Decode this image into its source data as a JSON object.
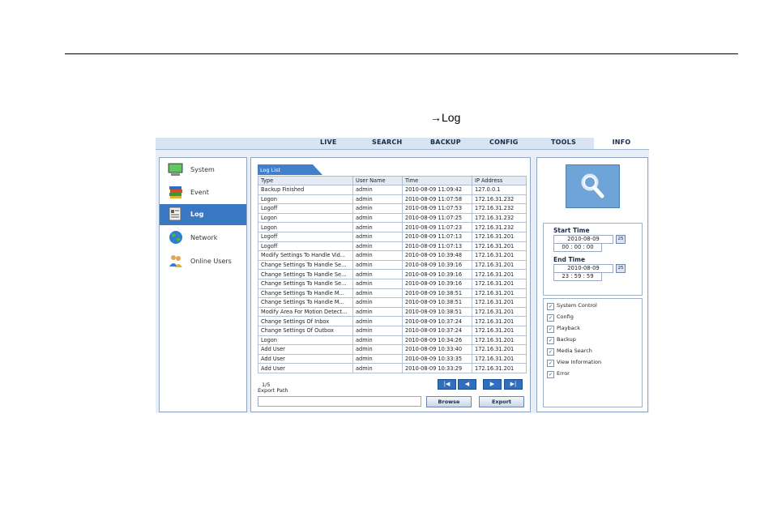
{
  "caption": "→Log",
  "topnav": {
    "tabs": [
      {
        "label": "LIVE"
      },
      {
        "label": "SEARCH"
      },
      {
        "label": "BACKUP"
      },
      {
        "label": "CONFIG"
      },
      {
        "label": "TOOLS"
      },
      {
        "label": "INFO"
      }
    ],
    "active": "INFO"
  },
  "sidebar": {
    "items": [
      {
        "label": "System",
        "icon": "monitor-icon"
      },
      {
        "label": "Event",
        "icon": "books-icon"
      },
      {
        "label": "Log",
        "icon": "log-icon"
      },
      {
        "label": "Network",
        "icon": "globe-icon"
      },
      {
        "label": "Online Users",
        "icon": "users-icon"
      }
    ],
    "active": "Log"
  },
  "log": {
    "tab_label": "Log List",
    "columns": [
      "Type",
      "User Name",
      "Time",
      "IP Address"
    ],
    "rows": [
      [
        "Backup Finished",
        "admin",
        "2010-08-09 11:09:42",
        "127.0.0.1"
      ],
      [
        "Logon",
        "admin",
        "2010-08-09 11:07:58",
        "172.16.31.232"
      ],
      [
        "Logoff",
        "admin",
        "2010-08-09 11:07:53",
        "172.16.31.232"
      ],
      [
        "Logon",
        "admin",
        "2010-08-09 11:07:25",
        "172.16.31.232"
      ],
      [
        "Logon",
        "admin",
        "2010-08-09 11:07:23",
        "172.16.31.232"
      ],
      [
        "Logoff",
        "admin",
        "2010-08-09 11:07:13",
        "172.16.31.201"
      ],
      [
        "Logoff",
        "admin",
        "2010-08-09 11:07:13",
        "172.16.31.201"
      ],
      [
        "Modify Settings To Handle Vid...",
        "admin",
        "2010-08-09 10:39:48",
        "172.16.31.201"
      ],
      [
        "Change Settings To Handle Se...",
        "admin",
        "2010-08-09 10:39:16",
        "172.16.31.201"
      ],
      [
        "Change Settings To Handle Se...",
        "admin",
        "2010-08-09 10:39:16",
        "172.16.31.201"
      ],
      [
        "Change Settings To Handle Se...",
        "admin",
        "2010-08-09 10:39:16",
        "172.16.31.201"
      ],
      [
        "Change Settings To Handle M...",
        "admin",
        "2010-08-09 10:38:51",
        "172.16.31.201"
      ],
      [
        "Change Settings To Handle M...",
        "admin",
        "2010-08-09 10:38:51",
        "172.16.31.201"
      ],
      [
        "Modify Area For Motion Detect...",
        "admin",
        "2010-08-09 10:38:51",
        "172.16.31.201"
      ],
      [
        "Change Settings Of Inbox",
        "admin",
        "2010-08-09 10:37:24",
        "172.16.31.201"
      ],
      [
        "Change Settings Of Outbox",
        "admin",
        "2010-08-09 10:37:24",
        "172.16.31.201"
      ],
      [
        "Logon",
        "admin",
        "2010-08-09 10:34:26",
        "172.16.31.201"
      ],
      [
        "Add User",
        "admin",
        "2010-08-09 10:33:40",
        "172.16.31.201"
      ],
      [
        "Add User",
        "admin",
        "2010-08-09 10:33:35",
        "172.16.31.201"
      ],
      [
        "Add User",
        "admin",
        "2010-08-09 10:33:29",
        "172.16.31.201"
      ]
    ],
    "page_info": "1/5",
    "export_path_label": "Export Path",
    "export_path_value": "",
    "browse_label": "Browse",
    "export_label": "Export",
    "pager": [
      "first-page-icon",
      "prev-page-icon",
      "next-page-icon",
      "last-page-icon"
    ]
  },
  "filters": {
    "search_icon": "magnifier-icon",
    "start_time_label": "Start Time",
    "start_date": "2010-08-09",
    "start_time": "00 : 00 : 00",
    "end_time_label": "End Time",
    "end_date": "2010-08-09",
    "end_time": "23 : 59 : 59",
    "calendar_label": "25",
    "categories": [
      {
        "label": "System Control",
        "checked": true
      },
      {
        "label": "Config",
        "checked": true
      },
      {
        "label": "Playback",
        "checked": true
      },
      {
        "label": "Backup",
        "checked": true
      },
      {
        "label": "Media Search",
        "checked": true
      },
      {
        "label": "View Information",
        "checked": true
      },
      {
        "label": "Error",
        "checked": true
      }
    ],
    "check_mark": "✓"
  },
  "colors": {
    "accent": "#3a78c4",
    "pager": "#2f6fc0",
    "nav_bg": "#d8e4f1"
  }
}
